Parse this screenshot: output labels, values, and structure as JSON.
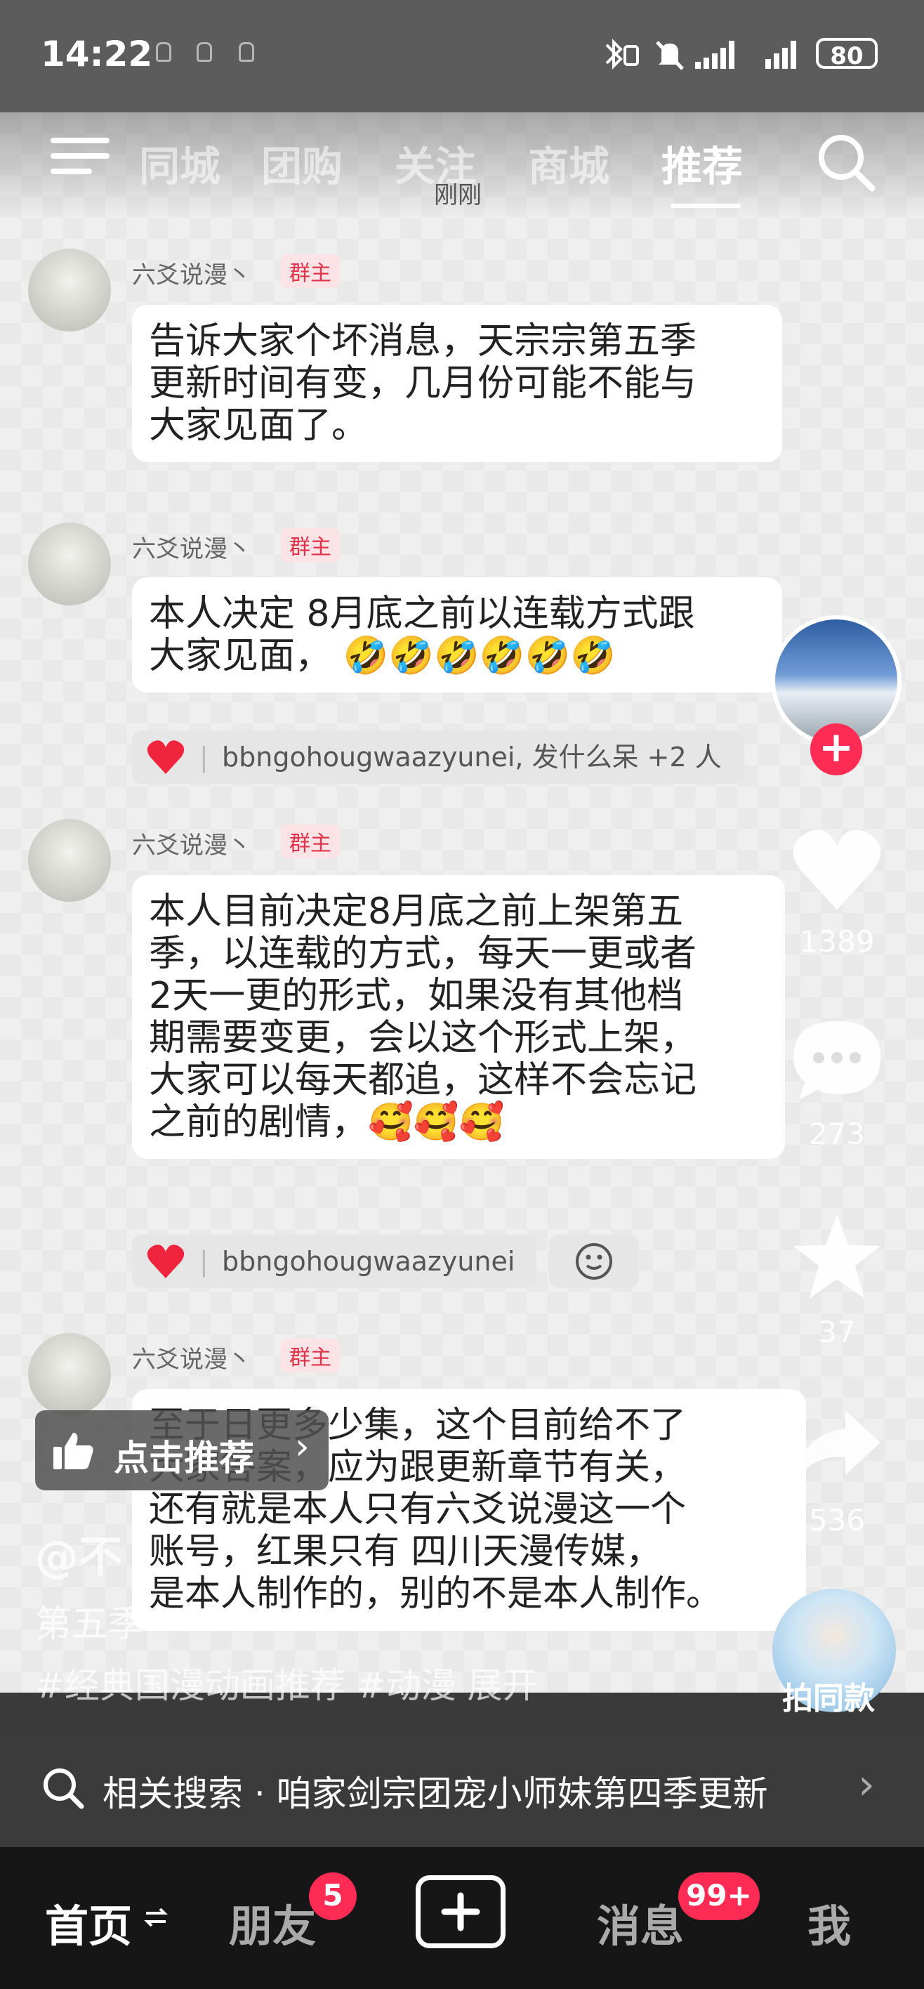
{
  "status_bar": {
    "time": "14:22",
    "battery": "80"
  },
  "top_nav": {
    "tabs": [
      "同城",
      "团购",
      "关注",
      "商城",
      "推荐"
    ],
    "active_tab": "推荐",
    "timestamp": "刚刚"
  },
  "messages": [
    {
      "sender": "六爻说漫丶",
      "badge": "群主",
      "lines": [
        "告诉大家个坏消息，天宗宗第五季",
        "更新时间有变，几月份可能不能与",
        "大家见面了。"
      ]
    },
    {
      "sender": "六爻说漫丶",
      "badge": "群主",
      "lines": [
        "本人决定 8月底之前以连载方式跟",
        "大家见面， 🤣🤣🤣🤣🤣🤣"
      ],
      "reactions": "bbngohougwaazyunei, 发什么呆 +2 人"
    },
    {
      "sender": "六爻说漫丶",
      "badge": "群主",
      "lines": [
        "本人目前决定8月底之前上架第五",
        "季，以连载的方式，每天一更或者",
        "2天一更的形式，如果没有其他档",
        "期需要变更，会以这个形式上架，",
        "大家可以每天都追，这样不会忘记",
        "之前的剧情，🥰🥰🥰"
      ],
      "reactions": "bbngohougwaazyunei"
    },
    {
      "sender": "六爻说漫丶",
      "badge": "群主",
      "lines": [
        "至于日更多少集，这个目前给不了",
        "大家答案，应为跟更新章节有关，",
        "还有就是本人只有六爻说漫这一个",
        "账号，红果只有 四川天漫传媒，",
        "是本人制作的，别的不是本人制作。"
      ]
    }
  ],
  "right_rail": {
    "likes": "1389",
    "comments": "273",
    "favorites": "37",
    "shares": "536",
    "same_style": "拍同款"
  },
  "recommend_button": "点击推荐",
  "author_overlay": {
    "handle": "@不",
    "desc_line": "第五季",
    "tags": "#经典国漫动画推荐 #动漫  展开"
  },
  "related_search": {
    "label": "相关搜索 · 咱家剑宗团宠小师妹第四季更新"
  },
  "bottom_tabs": {
    "home": "首页",
    "friends": "朋友",
    "friends_badge": "5",
    "messages": "消息",
    "messages_badge": "99+",
    "me": "我"
  },
  "colors": {
    "accent_red": "#fe2c55",
    "badge_red": "#e0334a",
    "heart_red": "#f0243c"
  }
}
